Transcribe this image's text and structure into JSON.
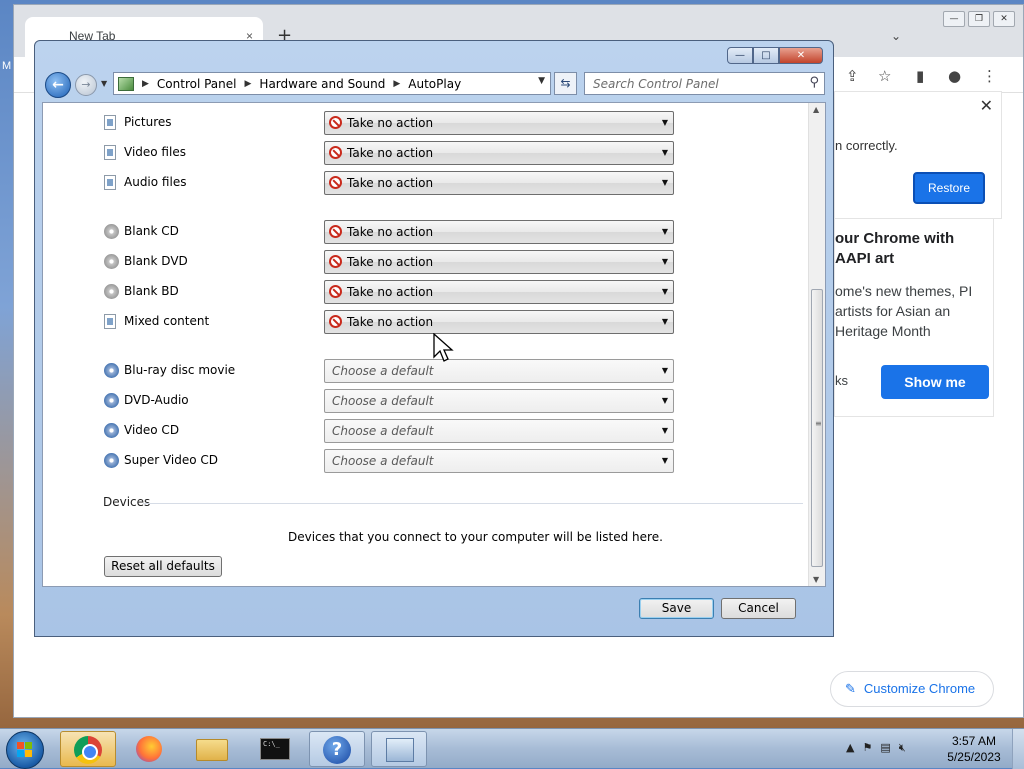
{
  "chrome": {
    "tab_title": "New Tab",
    "tab_close": "×",
    "new_tab": "+",
    "side_letter": "M",
    "panel_message": "n correctly.",
    "restore_label": "Restore",
    "promo_title": "our Chrome with AAPI art",
    "promo_body": "ome's new themes, PI artists for Asian an Heritage Month",
    "promo_link": "ks",
    "show_me_label": "Show me",
    "customize_label": "Customize Chrome"
  },
  "window": {
    "minimize": "—",
    "maximize": "□",
    "close": "✕"
  },
  "address": {
    "breadcrumb": [
      "Control Panel",
      "Hardware and Sound",
      "AutoPlay"
    ],
    "search_placeholder": "Search Control Panel"
  },
  "media_rows": [
    {
      "label": "Pictures",
      "icon": "file-icon",
      "value": "Take no action",
      "kind": "action"
    },
    {
      "label": "Video files",
      "icon": "file-icon",
      "value": "Take no action",
      "kind": "action"
    },
    {
      "label": "Audio files",
      "icon": "file-icon",
      "value": "Take no action",
      "kind": "action"
    },
    {
      "label": "Blank CD",
      "icon": "disc-icon",
      "value": "Take no action",
      "kind": "action"
    },
    {
      "label": "Blank DVD",
      "icon": "disc-icon",
      "value": "Take no action",
      "kind": "action"
    },
    {
      "label": "Blank BD",
      "icon": "disc-icon",
      "value": "Take no action",
      "kind": "action"
    },
    {
      "label": "Mixed content",
      "icon": "file-icon",
      "value": "Take no action",
      "kind": "action"
    },
    {
      "label": "Blu-ray disc movie",
      "icon": "movie-disc-icon",
      "value": "Choose a default",
      "kind": "default"
    },
    {
      "label": "DVD-Audio",
      "icon": "movie-disc-icon",
      "value": "Choose a default",
      "kind": "default"
    },
    {
      "label": "Video CD",
      "icon": "movie-disc-icon",
      "value": "Choose a default",
      "kind": "default"
    },
    {
      "label": "Super Video CD",
      "icon": "movie-disc-icon",
      "value": "Choose a default",
      "kind": "default"
    }
  ],
  "devices": {
    "heading": "Devices",
    "message": "Devices that you connect to your computer will be listed here."
  },
  "buttons": {
    "reset": "Reset all defaults",
    "save": "Save",
    "cancel": "Cancel"
  },
  "taskbar": {
    "time": "3:57 AM",
    "date": "5/25/2023",
    "help_glyph": "?",
    "cmd_text": "C:\\_"
  },
  "colors": {
    "accent_blue": "#1a73e8",
    "no_action_red": "#c92a1c"
  }
}
